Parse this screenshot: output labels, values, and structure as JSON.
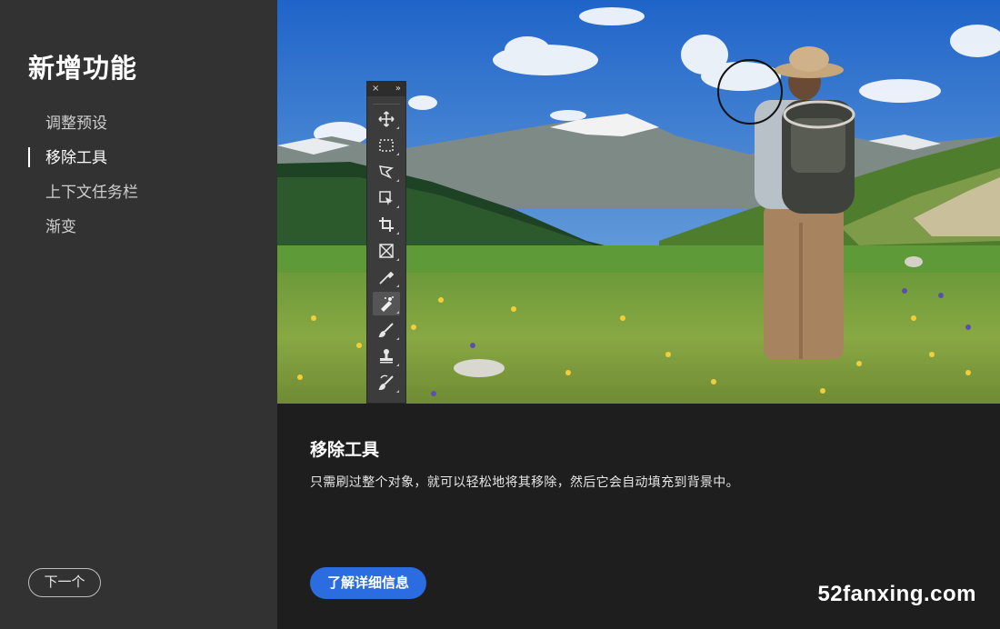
{
  "sidebar": {
    "title": "新增功能",
    "items": [
      {
        "label": "调整预设",
        "active": false
      },
      {
        "label": "移除工具",
        "active": true
      },
      {
        "label": "上下文任务栏",
        "active": false
      },
      {
        "label": "渐变",
        "active": false
      }
    ],
    "next_label": "下一个"
  },
  "toolbar": {
    "close_glyph": "×",
    "collapse_glyph": "»",
    "tools": [
      {
        "icon": "move-icon",
        "active": false
      },
      {
        "icon": "marquee-icon",
        "active": false
      },
      {
        "icon": "lasso-icon",
        "active": false
      },
      {
        "icon": "object-select-icon",
        "active": false
      },
      {
        "icon": "crop-icon",
        "active": false
      },
      {
        "icon": "frame-icon",
        "active": false
      },
      {
        "icon": "eyedropper-icon",
        "active": false
      },
      {
        "icon": "remove-tool-icon",
        "active": true
      },
      {
        "icon": "brush-icon",
        "active": false
      },
      {
        "icon": "stamp-icon",
        "active": false
      },
      {
        "icon": "history-brush-icon",
        "active": false
      }
    ]
  },
  "info": {
    "title": "移除工具",
    "description": "只需刷过整个对象，就可以轻松地将其移除，然后它会自动填充到背景中。",
    "learn_more_label": "了解详细信息"
  },
  "watermark": "52fanxing.com",
  "colors": {
    "sidebar_bg": "#323232",
    "panel_bg": "#1e1e1e",
    "accent": "#2b6ce0"
  }
}
